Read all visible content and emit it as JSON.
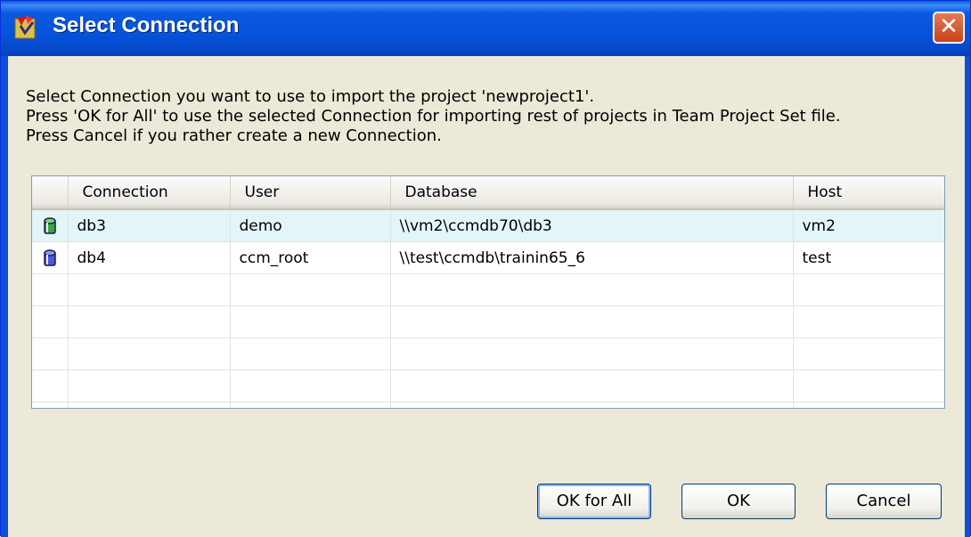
{
  "window": {
    "title": "Select Connection"
  },
  "message": {
    "line1": "Select Connection you want to use to import the project 'newproject1'.",
    "line2": "Press 'OK for All' to use the selected Connection for importing rest of projects in Team Project Set file.",
    "line3": "Press Cancel if you rather create a new Connection."
  },
  "table": {
    "columns": [
      "Connection",
      "User",
      "Database",
      "Host"
    ],
    "rows": [
      {
        "icon": "database-green-icon",
        "connection": "db3",
        "user": "demo",
        "database": "\\\\vm2\\ccmdb70\\db3",
        "host": "vm2",
        "selected": true
      },
      {
        "icon": "database-blue-icon",
        "connection": "db4",
        "user": "ccm_root",
        "database": "\\\\test\\ccmdb\\trainin65_6",
        "host": "test",
        "selected": false
      }
    ]
  },
  "buttons": {
    "ok_for_all": "OK for All",
    "ok": "OK",
    "cancel": "Cancel"
  },
  "colors": {
    "titlebar": "#0553dc",
    "selected_row": "#e2f5f8",
    "dialog_bg": "#ece9d8"
  }
}
